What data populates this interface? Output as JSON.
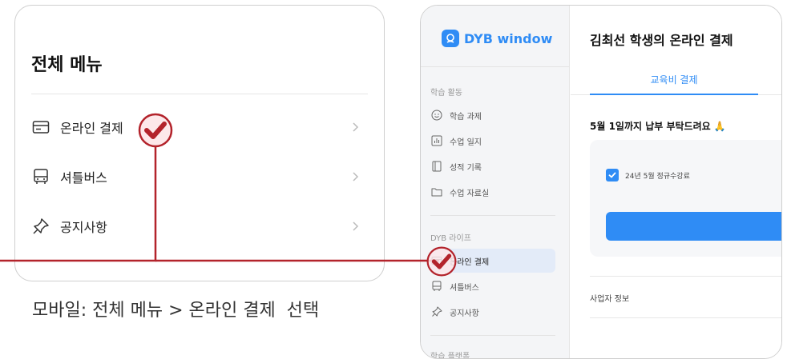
{
  "mobile": {
    "title": "전체 메뉴",
    "items": [
      {
        "label": "온라인 결제",
        "icon": "card-icon"
      },
      {
        "label": "셔틀버스",
        "icon": "bus-icon"
      },
      {
        "label": "공지사항",
        "icon": "pin-icon"
      }
    ],
    "caption": "모바일: 전체 메뉴 > 온라인 결제  선택"
  },
  "desktop": {
    "logo": "DYB window",
    "sections": [
      {
        "title": "학습 활동",
        "items": [
          {
            "label": "학습 과제",
            "icon": "smile-icon"
          },
          {
            "label": "수업 일지",
            "icon": "chart-icon"
          },
          {
            "label": "성적 기록",
            "icon": "book-icon"
          },
          {
            "label": "수업 자료실",
            "icon": "folder-icon"
          }
        ]
      },
      {
        "title": "DYB 라이프",
        "items": [
          {
            "label": "온라인 결제",
            "icon": "card-icon"
          },
          {
            "label": "셔틀버스",
            "icon": "bus-icon"
          },
          {
            "label": "공지사항",
            "icon": "pin-icon"
          }
        ]
      },
      {
        "title": "학습 플랫폼",
        "items": []
      }
    ],
    "main": {
      "title": "김최선 학생의 온라인 결제",
      "tab": "교육비 결제",
      "notice": "5월 1일까지 납부 부탁드려요 🙏",
      "payment_item": "24년 5월 정규수강료",
      "business_info": "사업자 정보"
    }
  },
  "colors": {
    "accent": "#2f8cf5",
    "marker": "#b3232b"
  }
}
